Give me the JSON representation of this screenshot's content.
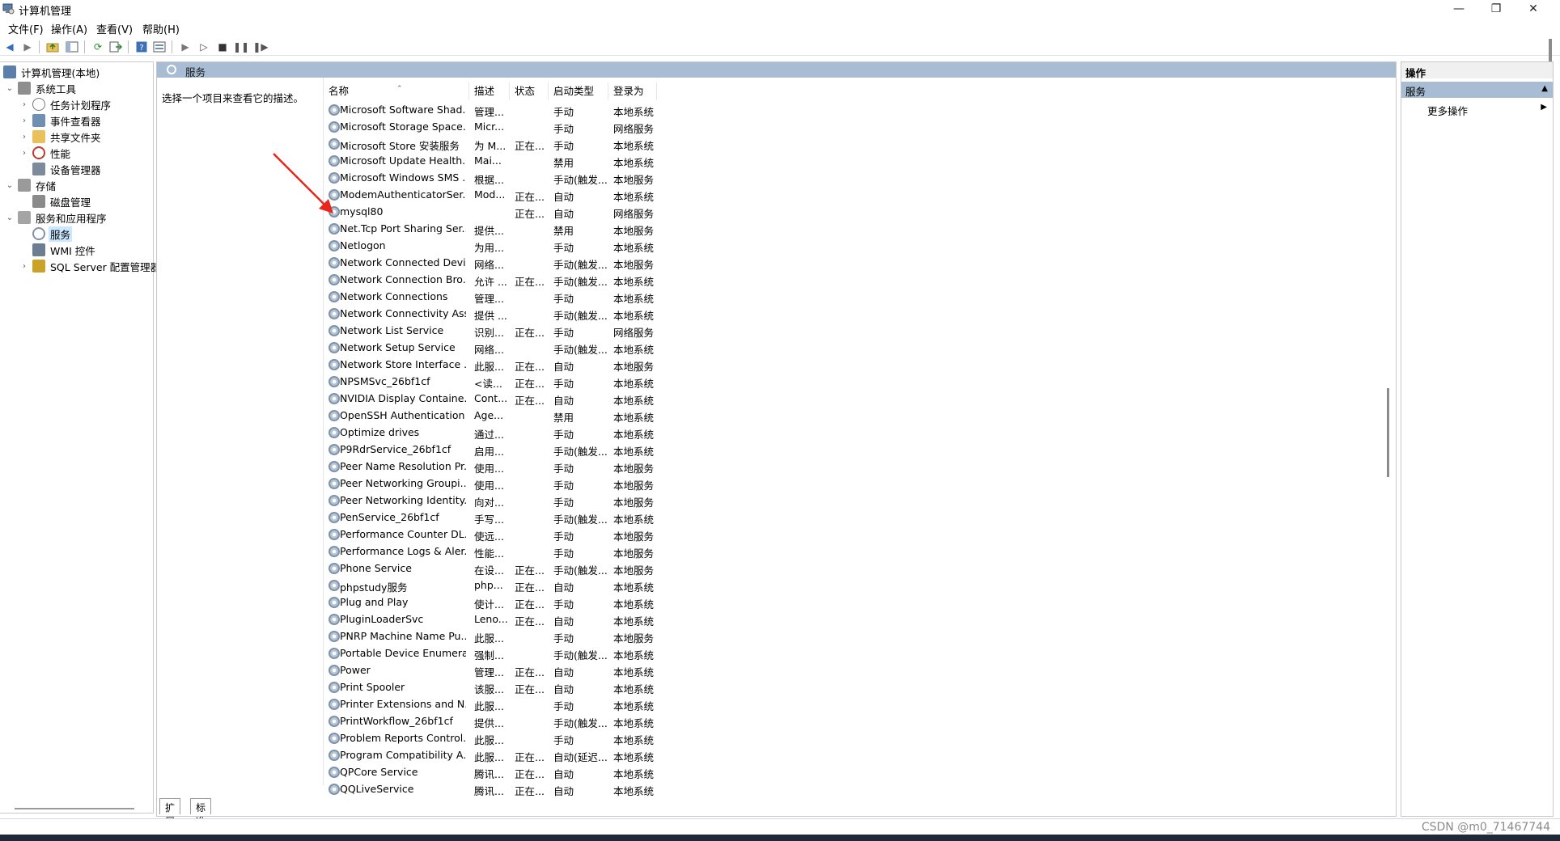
{
  "window": {
    "title": "计算机管理",
    "controls": {
      "minimize": "—",
      "restore": "❐",
      "close": "✕"
    }
  },
  "menu": [
    "文件(F)",
    "操作(A)",
    "查看(V)",
    "帮助(H)"
  ],
  "tree": [
    {
      "label": "计算机管理(本地)",
      "expander": "",
      "depth": 0
    },
    {
      "label": "系统工具",
      "expander": "⌄",
      "depth": 1
    },
    {
      "label": "任务计划程序",
      "expander": "›",
      "depth": 2
    },
    {
      "label": "事件查看器",
      "expander": "›",
      "depth": 2
    },
    {
      "label": "共享文件夹",
      "expander": "›",
      "depth": 2
    },
    {
      "label": "性能",
      "expander": "›",
      "depth": 2
    },
    {
      "label": "设备管理器",
      "expander": "",
      "depth": 2
    },
    {
      "label": "存储",
      "expander": "⌄",
      "depth": 1
    },
    {
      "label": "磁盘管理",
      "expander": "",
      "depth": 2
    },
    {
      "label": "服务和应用程序",
      "expander": "⌄",
      "depth": 1
    },
    {
      "label": "服务",
      "expander": "",
      "depth": 2,
      "selected": true
    },
    {
      "label": "WMI 控件",
      "expander": "",
      "depth": 2
    },
    {
      "label": "SQL Server 配置管理器",
      "expander": "›",
      "depth": 2
    }
  ],
  "center": {
    "header_title": "服务",
    "description_hint": "选择一个项目来查看它的描述。",
    "columns": [
      "名称",
      "描述",
      "状态",
      "启动类型",
      "登录为"
    ],
    "rows": [
      [
        "Microsoft Software Shad...",
        "管理...",
        "",
        "手动",
        "本地系统"
      ],
      [
        "Microsoft Storage Space...",
        "Micr...",
        "",
        "手动",
        "网络服务"
      ],
      [
        "Microsoft Store 安装服务",
        "为 M...",
        "正在...",
        "手动",
        "本地系统"
      ],
      [
        "Microsoft Update Health...",
        "Mai...",
        "",
        "禁用",
        "本地系统"
      ],
      [
        "Microsoft Windows SMS ...",
        "根据...",
        "",
        "手动(触发...",
        "本地服务"
      ],
      [
        "ModemAuthenticatorSer...",
        "Mod...",
        "正在...",
        "自动",
        "本地系统"
      ],
      [
        "mysql80",
        "",
        "正在...",
        "自动",
        "网络服务"
      ],
      [
        "Net.Tcp Port Sharing Ser...",
        "提供...",
        "",
        "禁用",
        "本地服务"
      ],
      [
        "Netlogon",
        "为用...",
        "",
        "手动",
        "本地系统"
      ],
      [
        "Network Connected Devi...",
        "网络...",
        "",
        "手动(触发...",
        "本地服务"
      ],
      [
        "Network Connection Bro...",
        "允许 ...",
        "正在...",
        "手动(触发...",
        "本地系统"
      ],
      [
        "Network Connections",
        "管理...",
        "",
        "手动",
        "本地系统"
      ],
      [
        "Network Connectivity Ass...",
        "提供 ...",
        "",
        "手动(触发...",
        "本地系统"
      ],
      [
        "Network List Service",
        "识别...",
        "正在...",
        "手动",
        "网络服务"
      ],
      [
        "Network Setup Service",
        "网络...",
        "",
        "手动(触发...",
        "本地系统"
      ],
      [
        "Network Store Interface ...",
        "此服...",
        "正在...",
        "自动",
        "本地服务"
      ],
      [
        "NPSMSvc_26bf1cf",
        "<读...",
        "正在...",
        "手动",
        "本地系统"
      ],
      [
        "NVIDIA Display Containe...",
        "Cont...",
        "正在...",
        "自动",
        "本地系统"
      ],
      [
        "OpenSSH Authentication ...",
        "Age...",
        "",
        "禁用",
        "本地系统"
      ],
      [
        "Optimize drives",
        "通过...",
        "",
        "手动",
        "本地系统"
      ],
      [
        "P9RdrService_26bf1cf",
        "启用...",
        "",
        "手动(触发...",
        "本地系统"
      ],
      [
        "Peer Name Resolution Pr...",
        "使用...",
        "",
        "手动",
        "本地服务"
      ],
      [
        "Peer Networking Groupi...",
        "使用...",
        "",
        "手动",
        "本地服务"
      ],
      [
        "Peer Networking Identity...",
        "向对...",
        "",
        "手动",
        "本地服务"
      ],
      [
        "PenService_26bf1cf",
        "手写...",
        "",
        "手动(触发...",
        "本地系统"
      ],
      [
        "Performance Counter DL...",
        "使远...",
        "",
        "手动",
        "本地服务"
      ],
      [
        "Performance Logs & Aler...",
        "性能...",
        "",
        "手动",
        "本地服务"
      ],
      [
        "Phone Service",
        "在设...",
        "正在...",
        "手动(触发...",
        "本地服务"
      ],
      [
        "phpstudy服务",
        "php...",
        "正在...",
        "自动",
        "本地系统"
      ],
      [
        "Plug and Play",
        "使计...",
        "正在...",
        "手动",
        "本地系统"
      ],
      [
        "PluginLoaderSvc",
        "Leno...",
        "正在...",
        "自动",
        "本地系统"
      ],
      [
        "PNRP Machine Name Pu...",
        "此服...",
        "",
        "手动",
        "本地服务"
      ],
      [
        "Portable Device Enumera...",
        "强制...",
        "",
        "手动(触发...",
        "本地系统"
      ],
      [
        "Power",
        "管理...",
        "正在...",
        "自动",
        "本地系统"
      ],
      [
        "Print Spooler",
        "该服...",
        "正在...",
        "自动",
        "本地系统"
      ],
      [
        "Printer Extensions and N...",
        "此服...",
        "",
        "手动",
        "本地系统"
      ],
      [
        "PrintWorkflow_26bf1cf",
        "提供...",
        "",
        "手动(触发...",
        "本地系统"
      ],
      [
        "Problem Reports Control...",
        "此服...",
        "",
        "手动",
        "本地系统"
      ],
      [
        "Program Compatibility A...",
        "此服...",
        "正在...",
        "自动(延迟...",
        "本地系统"
      ],
      [
        "QPCore Service",
        "腾讯...",
        "正在...",
        "自动",
        "本地系统"
      ],
      [
        "QQLiveService",
        "腾讯...",
        "正在...",
        "自动",
        "本地系统"
      ]
    ],
    "tabs": [
      "扩展",
      "标准"
    ]
  },
  "actions": {
    "header": "操作",
    "section": "服务",
    "more": "更多操作"
  },
  "watermark": "CSDN @m0_71467744",
  "colors": {
    "header_blue": "#a8bcd3",
    "selection": "#cce8ff",
    "annotation_arrow": "#e8261b"
  }
}
